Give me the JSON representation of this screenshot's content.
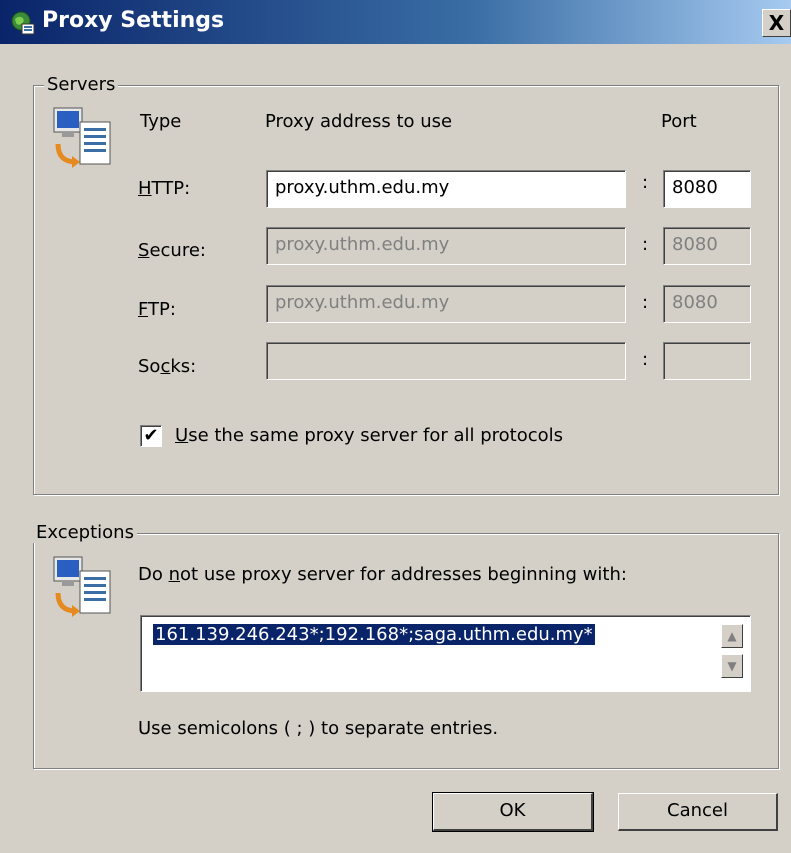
{
  "window": {
    "title": "Proxy Settings",
    "close_label": "X"
  },
  "servers": {
    "legend": "Servers",
    "col_type": "Type",
    "col_address": "Proxy address to use",
    "col_port": "Port",
    "colon": ":",
    "rows": [
      {
        "label": "HTTP:",
        "address": "proxy.uthm.edu.my",
        "port": "8080",
        "enabled": true
      },
      {
        "label": "Secure:",
        "address": "proxy.uthm.edu.my",
        "port": "8080",
        "enabled": false
      },
      {
        "label": "FTP:",
        "address": "proxy.uthm.edu.my",
        "port": "8080",
        "enabled": false
      },
      {
        "label": "Socks:",
        "address": "",
        "port": "",
        "enabled": false
      }
    ],
    "same_proxy_label": "Use the same proxy server for all protocols",
    "same_proxy_checked": true
  },
  "exceptions": {
    "legend": "Exceptions",
    "instruction": "Do not use proxy server for addresses beginning with:",
    "value": "161.139.246.243*;192.168*;saga.uthm.edu.my*",
    "hint": "Use semicolons ( ; ) to separate entries."
  },
  "buttons": {
    "ok": "OK",
    "cancel": "Cancel"
  },
  "icons": {
    "title": "network-globe-icon",
    "servers": "computer-document-icon",
    "exceptions": "computer-document-icon"
  }
}
